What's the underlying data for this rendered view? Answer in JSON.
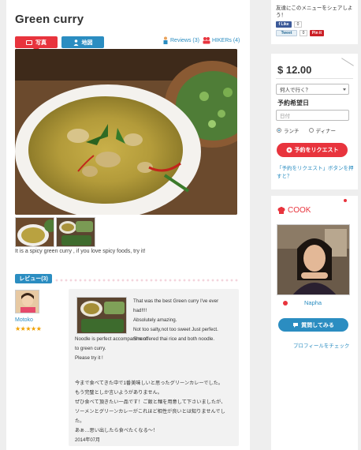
{
  "dish": {
    "title": "Green curry",
    "caption": "It is a spicy green curry , if you love spicy foods, try it!"
  },
  "tabs": [
    {
      "label": "写真"
    },
    {
      "label": "地図"
    }
  ],
  "meta": {
    "reviews_label": "Reviews (3)",
    "hikers_label": "HIKERs (4)"
  },
  "review_section": {
    "tab_label": "レビュー(3)",
    "reviewer_name": "Motoko",
    "stars": "★★★★★",
    "text_en_top": [
      "That was the best Green curry I've ever",
      "had!!!!",
      "Absolutely amazing.",
      "Not too salty,not too sweet Just perfect.",
      "She offered thai rice and both noodle."
    ],
    "text_en_bottom": [
      "Noodle is perfect accompaniment",
      "to green curry.",
      "Please try it !"
    ],
    "text_jp": [
      "今まで食べてきた中で1番美味しいと思ったグリーンカレーでした。",
      "もう完璧としか言いようがありません。",
      "ぜひ食べて頂きたい一品です！ご飯と麺を用意して下さいましたが、",
      "ソーメンとグリーンカレーがこれほど相性が良いとは知りませんでし",
      "た。",
      "あぁ…思い出したら食べたくなる〜！"
    ],
    "date": "2014年07月"
  },
  "share": {
    "text": "友達にこのメニューをシェアしよう！",
    "fb_label": "f Like",
    "fb_count": "0",
    "tweet_label": "Tweet",
    "tweet_count": "0",
    "pin_label": "Pin it"
  },
  "booking": {
    "price": "$ 12.00",
    "people_select": "何人で行く？",
    "date_label": "予約希望日",
    "date_placeholder": "日付",
    "lunch": "ランチ",
    "dinner": "ディナー",
    "request_button": "予約をリクエスト",
    "note": "「予約をリクエスト」ボタンを押すと？"
  },
  "cook": {
    "heading": "COOK",
    "name": "Napha",
    "ask_button": "質問してみる",
    "profile_link": "プロフィールをチェック"
  },
  "colors": {
    "red": "#e8343d",
    "blue": "#2b8dc1"
  }
}
